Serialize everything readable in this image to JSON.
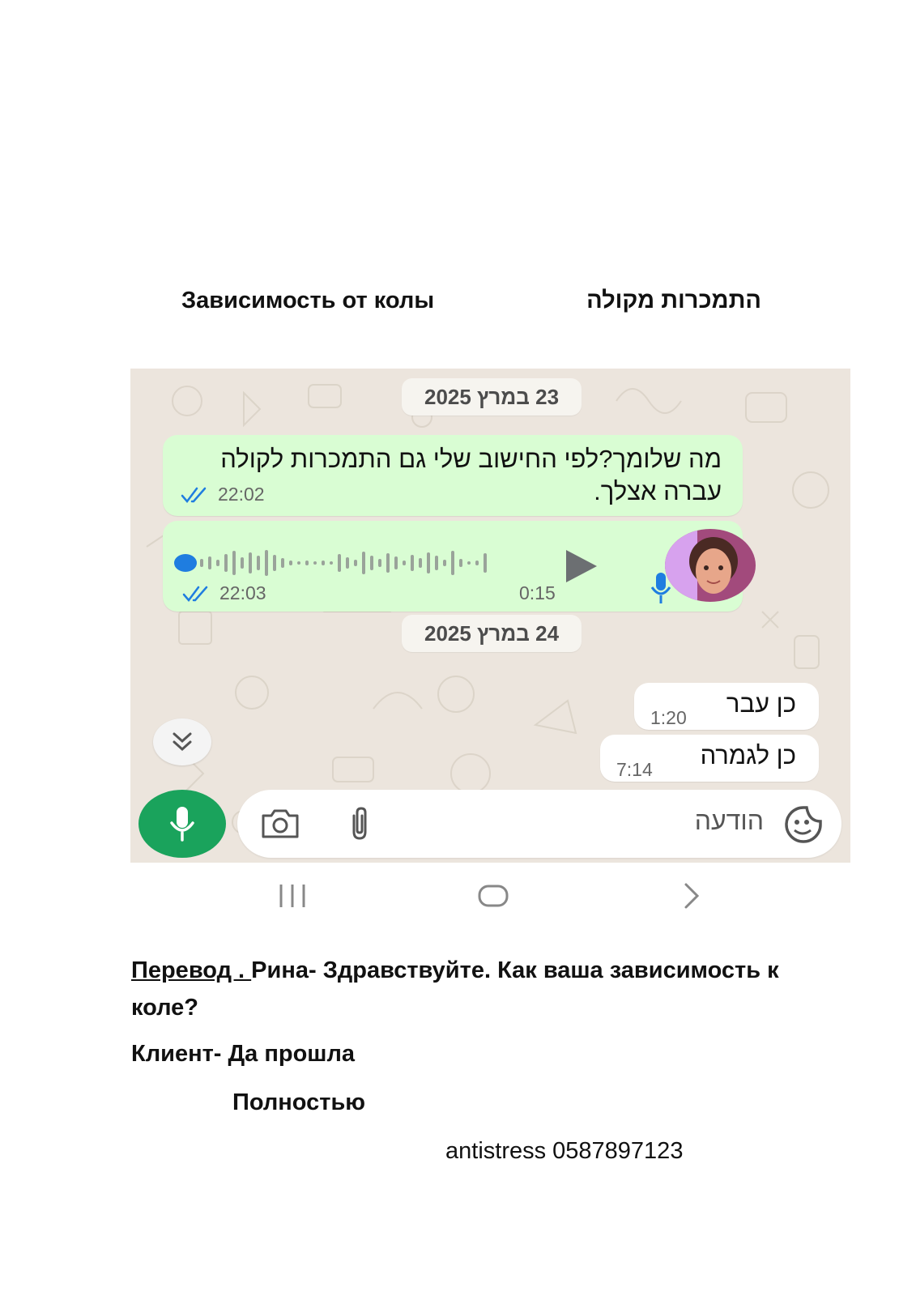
{
  "headings": {
    "russian": "Зависимость от колы",
    "hebrew": "התמכרות מקולה"
  },
  "chat": {
    "date_1": "23 במרץ 2025",
    "date_2": "24 במרץ 2025",
    "message_1": {
      "text": "מה שלומך?לפי החישוב שלי גם התמכרות לקולה עברה אצלך.",
      "time": "22:02",
      "status_icon": "double-check-icon"
    },
    "voice_message": {
      "duration": "0:15",
      "time": "22:03",
      "status_icon": "double-check-icon"
    },
    "reply_1": {
      "text": "כן עבר",
      "time": "1:20"
    },
    "reply_2": {
      "text": "כן לגמרה",
      "time": "7:14"
    },
    "input": {
      "placeholder": "הודעה",
      "icons": [
        "camera-icon",
        "paperclip-icon",
        "sticker-icon",
        "microphone-icon"
      ]
    }
  },
  "navbar": {
    "icons": [
      "recent-apps-icon",
      "home-icon",
      "back-icon"
    ]
  },
  "translation": {
    "label": "Перевод . ",
    "line_1": "Рина-  Здравствуйте. Как ваша зависимость к коле?",
    "line_2": "Клиент- Да прошла",
    "line_3": "Полностью"
  },
  "contact": "antistress 0587897123",
  "colors": {
    "outgoing_bubble": "#d9fdd3",
    "incoming_bubble": "#ffffff",
    "chat_background": "#ece5dd",
    "mic_button": "#1aa35c",
    "read_ticks": "#1f7de0"
  }
}
